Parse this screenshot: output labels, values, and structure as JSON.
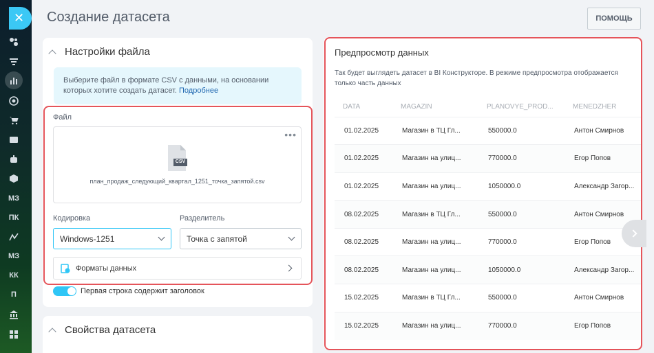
{
  "page": {
    "title": "Создание датасета",
    "help_label": "помощь"
  },
  "rail": {
    "items": [
      "МЗ",
      "ПК",
      "МЗ",
      "КК",
      "П"
    ]
  },
  "file_settings": {
    "title": "Настройки файла",
    "info_text": "Выберите файл в формате CSV с данными, на основании которых хотите создать датасет.",
    "info_link": "Подробнее",
    "file_label": "Файл",
    "file_badge": "CSV",
    "file_name": "план_продаж_следующий_квартал_1251_точка_запятой.csv",
    "encoding_label": "Кодировка",
    "encoding_value": "Windows-1251",
    "separator_label": "Разделитель",
    "separator_value": "Точка с запятой",
    "formats_label": "Форматы данных",
    "toggle_label": "Первая строка содержит заголовок",
    "toggle_on": true
  },
  "dataset_props": {
    "title": "Свойства датасета"
  },
  "preview": {
    "title": "Предпросмотр данных",
    "description": "Так будет выглядеть датасет в BI Конструкторе. В режиме предпросмотра отображается только часть данных",
    "columns": [
      "DATA",
      "MAGAZIN",
      "PLANOVYE_PROD...",
      "MENEDZHER"
    ],
    "rows": [
      [
        "01.02.2025",
        "Магазин в ТЦ Гл...",
        "550000.0",
        "Антон Смирнов"
      ],
      [
        "01.02.2025",
        "Магазин на улиц...",
        "770000.0",
        "Егор Попов"
      ],
      [
        "01.02.2025",
        "Магазин на улиц...",
        "1050000.0",
        "Александр Загор..."
      ],
      [
        "08.02.2025",
        "Магазин в ТЦ Гл...",
        "550000.0",
        "Антон Смирнов"
      ],
      [
        "08.02.2025",
        "Магазин на улиц...",
        "770000.0",
        "Егор Попов"
      ],
      [
        "08.02.2025",
        "Магазин на улиц...",
        "1050000.0",
        "Александр Загор..."
      ],
      [
        "15.02.2025",
        "Магазин в ТЦ Гл...",
        "550000.0",
        "Антон Смирнов"
      ],
      [
        "15.02.2025",
        "Магазин на улиц...",
        "770000.0",
        "Егор Попов"
      ]
    ]
  },
  "colors": {
    "accent": "#2fc6f6",
    "highlight": "#e5545a",
    "rail_close": "#3bc8f5"
  }
}
